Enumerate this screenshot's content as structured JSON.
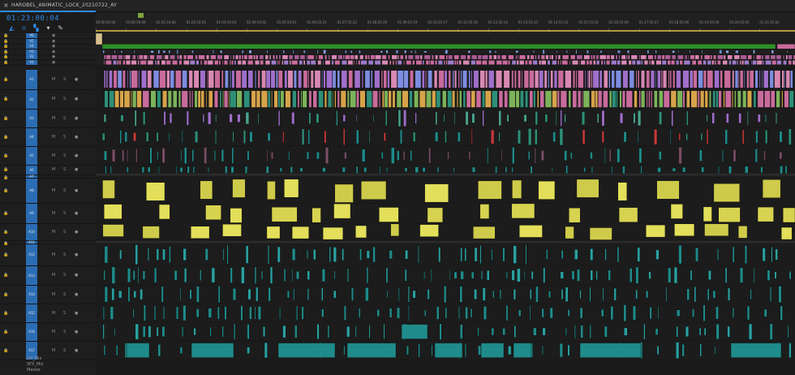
{
  "tab": {
    "close_glyph": "×",
    "title": "HAROBEL_ANIMATIC_LOCK_20210722_AY"
  },
  "timecode": "01:23:00:04",
  "tools": [
    "snap-icon",
    "link-icon",
    "add-marker-icon",
    "marker-icon",
    "wrench-icon"
  ],
  "ruler": {
    "ticks": [
      "00:00:00:00",
      "01:00:56:09",
      "01:01:54:06",
      "01:02:54:05",
      "01:03:54:03",
      "01:04:54:02",
      "01:05:54:01",
      "01:06:55:21",
      "01:07:55:22",
      "01:08:55:20",
      "01:09:55:19",
      "01:10:55:17",
      "01:11:55:16",
      "01:12:55:14",
      "01:13:55:13",
      "01:14:55:12",
      "01:15:55:10",
      "01:16:55:09",
      "01:17:55:07",
      "01:18:55:06",
      "01:19:55:04",
      "01:20:55:03",
      "01:21:55:02"
    ]
  },
  "video_tracks": [
    "V6",
    "V5",
    "V4",
    "V3",
    "V2",
    "V1"
  ],
  "audio_tracks": [
    "A1",
    "A2",
    "A3",
    "A4",
    "A5",
    "A6",
    "A7",
    "A8",
    "A9",
    "A10",
    "A11",
    "A12",
    "A13",
    "A14",
    "A15",
    "A16",
    "A17"
  ],
  "track_buttons": {
    "mute": "M",
    "solo": "S"
  },
  "mix_tracks": [
    "DX_Mix",
    "SFX_Mix",
    "Master"
  ],
  "colors": {
    "accent": "#2d8ceb",
    "green": "#2f8f2a",
    "pink": "#c86b9c",
    "yellow": "#e3df5a",
    "teal": "#1f8b8a"
  }
}
